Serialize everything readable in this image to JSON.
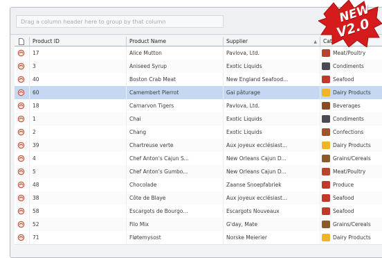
{
  "group_panel": {
    "hint": "Drag a column header here to group by that column"
  },
  "columns": {
    "id": "Product ID",
    "name": "Product Name",
    "supplier": "Supplier",
    "category": "Cate"
  },
  "badge": {
    "line1": "NEW",
    "line2": "V2.0"
  },
  "rows": [
    {
      "id": "17",
      "name": "Alice Mutton",
      "supplier": "Pavlova, Ltd.",
      "category": "Meat/Poultry",
      "cat_color": "#b4452e",
      "selected": false
    },
    {
      "id": "3",
      "name": "Aniseed Syrup",
      "supplier": "Exotic Liquids",
      "category": "Condiments",
      "cat_color": "#4a4a55",
      "selected": false
    },
    {
      "id": "40",
      "name": "Boston Crab Meat",
      "supplier": "New England Seafood...",
      "category": "Seafood",
      "cat_color": "#c0392b",
      "selected": false
    },
    {
      "id": "60",
      "name": "Camembert Pierrot",
      "supplier": "Gai pâturage",
      "category": "Dairy Products",
      "cat_color": "#f0b429",
      "selected": true
    },
    {
      "id": "18",
      "name": "Carnarvon Tigers",
      "supplier": "Pavlova, Ltd.",
      "category": "Beverages",
      "cat_color": "#8a4b22",
      "selected": false
    },
    {
      "id": "1",
      "name": "Chai",
      "supplier": "Exotic Liquids",
      "category": "Condiments",
      "cat_color": "#4a4a55",
      "selected": false
    },
    {
      "id": "2",
      "name": "Chang",
      "supplier": "Exotic Liquids",
      "category": "Confections",
      "cat_color": "#a0522d",
      "selected": false
    },
    {
      "id": "39",
      "name": "Chartreuse verte",
      "supplier": "Aux joyeux ecclésiast...",
      "category": "Dairy Products",
      "cat_color": "#f0b429",
      "selected": false
    },
    {
      "id": "4",
      "name": "Chef Anton's Cajun S...",
      "supplier": "New Orleans Cajun D...",
      "category": "Grains/Cereals",
      "cat_color": "#8b5a2b",
      "selected": false
    },
    {
      "id": "5",
      "name": "Chef Anton's Gumbo...",
      "supplier": "New Orleans Cajun D...",
      "category": "Meat/Poultry",
      "cat_color": "#b4452e",
      "selected": false
    },
    {
      "id": "48",
      "name": "Chocolade",
      "supplier": "Zaanse Snoepfabriek",
      "category": "Produce",
      "cat_color": "#c0392b",
      "selected": false
    },
    {
      "id": "38",
      "name": "Côte de Blaye",
      "supplier": "Aux joyeux ecclésiast...",
      "category": "Seafood",
      "cat_color": "#c0392b",
      "selected": false
    },
    {
      "id": "58",
      "name": "Escargots de Bourgo...",
      "supplier": "Escargots Nouveaux",
      "category": "Seafood",
      "cat_color": "#c0392b",
      "selected": false
    },
    {
      "id": "52",
      "name": "Filo Mix",
      "supplier": "G'day, Mate",
      "category": "Grains/Cereals",
      "cat_color": "#8b5a2b",
      "selected": false
    },
    {
      "id": "71",
      "name": "Fløtemysost",
      "supplier": "Norske Meierier",
      "category": "Dairy Products",
      "cat_color": "#f0b429",
      "selected": false
    }
  ]
}
